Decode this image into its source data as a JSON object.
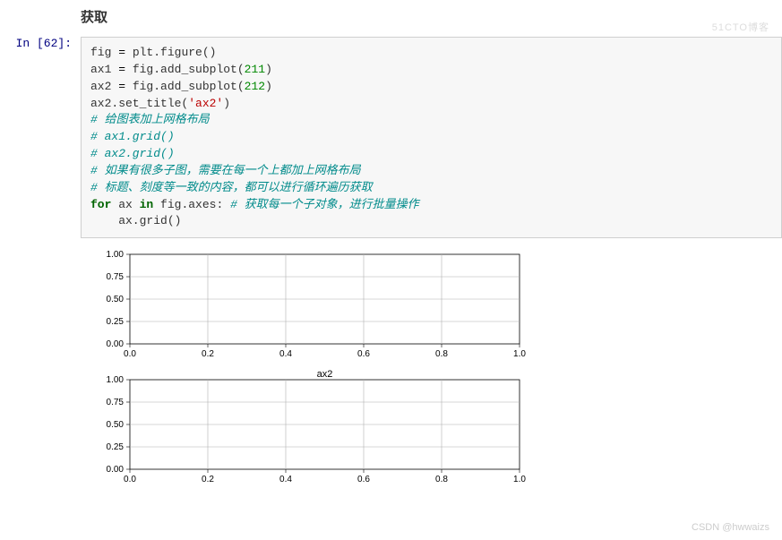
{
  "heading": "获取",
  "prompt": {
    "pre": "In  [",
    "num": "62",
    "post": "]:"
  },
  "code": {
    "l1a": "fig ",
    "l1b": "=",
    "l1c": " plt.figure()",
    "l2a": "ax1 ",
    "l2b": "=",
    "l2c": " fig.add_subplot(",
    "l2n": "211",
    "l2d": ")",
    "l3a": "ax2 ",
    "l3b": "=",
    "l3c": " fig.add_subplot(",
    "l3n": "212",
    "l3d": ")",
    "l4a": "ax2.set_title(",
    "l4s": "'ax2'",
    "l4b": ")",
    "l5": "# 给图表加上网格布局",
    "l6": "# ax1.grid()",
    "l7": "# ax2.grid()",
    "l8": "# 如果有很多子图，需要在每一个上都加上网格布局",
    "l9": "# 标题、刻度等一致的内容，都可以进行循环遍历获取",
    "l10a": "for",
    "l10b": " ax ",
    "l10c": "in",
    "l10d": " fig.axes: ",
    "l10e": "# 获取每一个子对象，进行批量操作",
    "l11": "    ax.grid()"
  },
  "chart_data": [
    {
      "type": "line",
      "x": [],
      "y": [],
      "title": "",
      "xlabel": "",
      "ylabel": "",
      "xlim": [
        0.0,
        1.0
      ],
      "ylim": [
        0.0,
        1.0
      ],
      "xticks": [
        "0.0",
        "0.2",
        "0.4",
        "0.6",
        "0.8",
        "1.0"
      ],
      "yticks": [
        "0.00",
        "0.25",
        "0.50",
        "0.75",
        "1.00"
      ],
      "grid": true
    },
    {
      "type": "line",
      "x": [],
      "y": [],
      "title": "ax2",
      "xlabel": "",
      "ylabel": "",
      "xlim": [
        0.0,
        1.0
      ],
      "ylim": [
        0.0,
        1.0
      ],
      "xticks": [
        "0.0",
        "0.2",
        "0.4",
        "0.6",
        "0.8",
        "1.0"
      ],
      "yticks": [
        "0.00",
        "0.25",
        "0.50",
        "0.75",
        "1.00"
      ],
      "grid": true
    }
  ],
  "watermark_top": "51CTO博客",
  "watermark_bot": "CSDN @hwwaizs"
}
